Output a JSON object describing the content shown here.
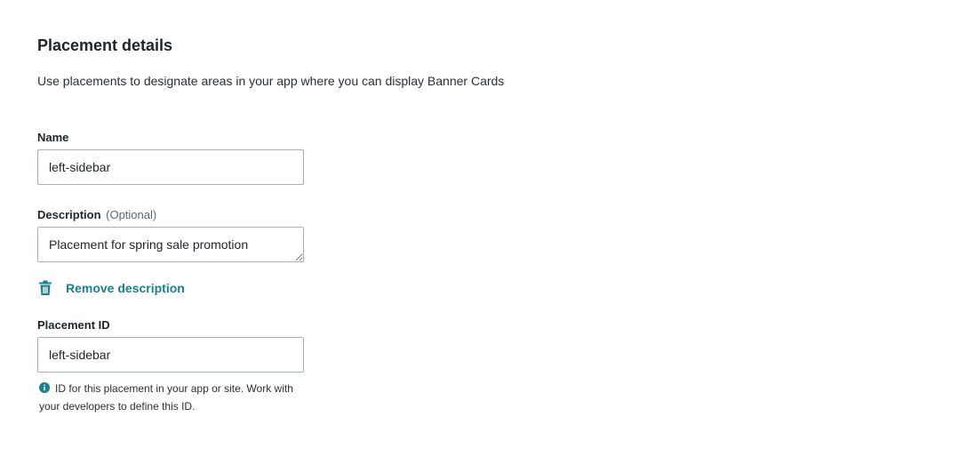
{
  "section": {
    "title": "Placement details",
    "subtitle": "Use placements to designate areas in your app where you can display Banner Cards"
  },
  "name_field": {
    "label": "Name",
    "value": "left-sidebar"
  },
  "description_field": {
    "label": "Description",
    "optional_label": "(Optional)",
    "value": "Placement for spring sale promotion"
  },
  "remove_description": {
    "label": "Remove description",
    "icon": "trash-icon"
  },
  "placement_id_field": {
    "label": "Placement ID",
    "value": "left-sidebar",
    "help_text": "ID for this placement in your app or site. Work with your developers to define this ID.",
    "help_icon": "info-icon"
  },
  "colors": {
    "accent": "#1f7f8c",
    "text": "#1f2429",
    "border": "#a9b0b7"
  }
}
